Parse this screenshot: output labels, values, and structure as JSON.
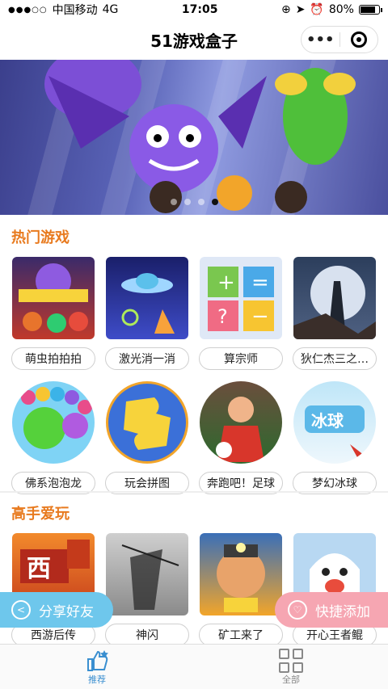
{
  "status_bar": {
    "carrier": "中国移动",
    "network": "4G",
    "time": "17:05",
    "battery": "80%"
  },
  "nav": {
    "title": "51游戏盒子",
    "more_label": "•••"
  },
  "banner": {
    "active_page": 3
  },
  "hot": {
    "title": "热门游戏",
    "row1": [
      {
        "name": "萌虫拍拍拍",
        "icon": "cartoon-monsters"
      },
      {
        "name": "激光消一消",
        "icon": "ufo-space"
      },
      {
        "name": "算宗师",
        "icon": "math-symbols"
      },
      {
        "name": "狄仁杰三之…",
        "icon": "moon-warrior"
      }
    ],
    "row2": [
      {
        "name": "佛系泡泡龙",
        "icon": "bubbles"
      },
      {
        "name": "玩会拼图",
        "icon": "puzzle-piece"
      },
      {
        "name": "奔跑吧！足球",
        "icon": "football-player"
      },
      {
        "name": "梦幻冰球",
        "icon": "ice-hockey"
      }
    ]
  },
  "pro": {
    "title": "高手爱玩",
    "games": [
      {
        "name": "西游后传",
        "icon": "journey-west"
      },
      {
        "name": "神闪",
        "icon": "ink-swordsman"
      },
      {
        "name": "矿工来了",
        "icon": "miner"
      },
      {
        "name": "开心王者鲲",
        "icon": "happy-ghost"
      }
    ]
  },
  "floating": {
    "share": "分享好友",
    "quick_add": "快捷添加"
  },
  "tabbar": {
    "recommend": "推荐",
    "all": "全部"
  }
}
